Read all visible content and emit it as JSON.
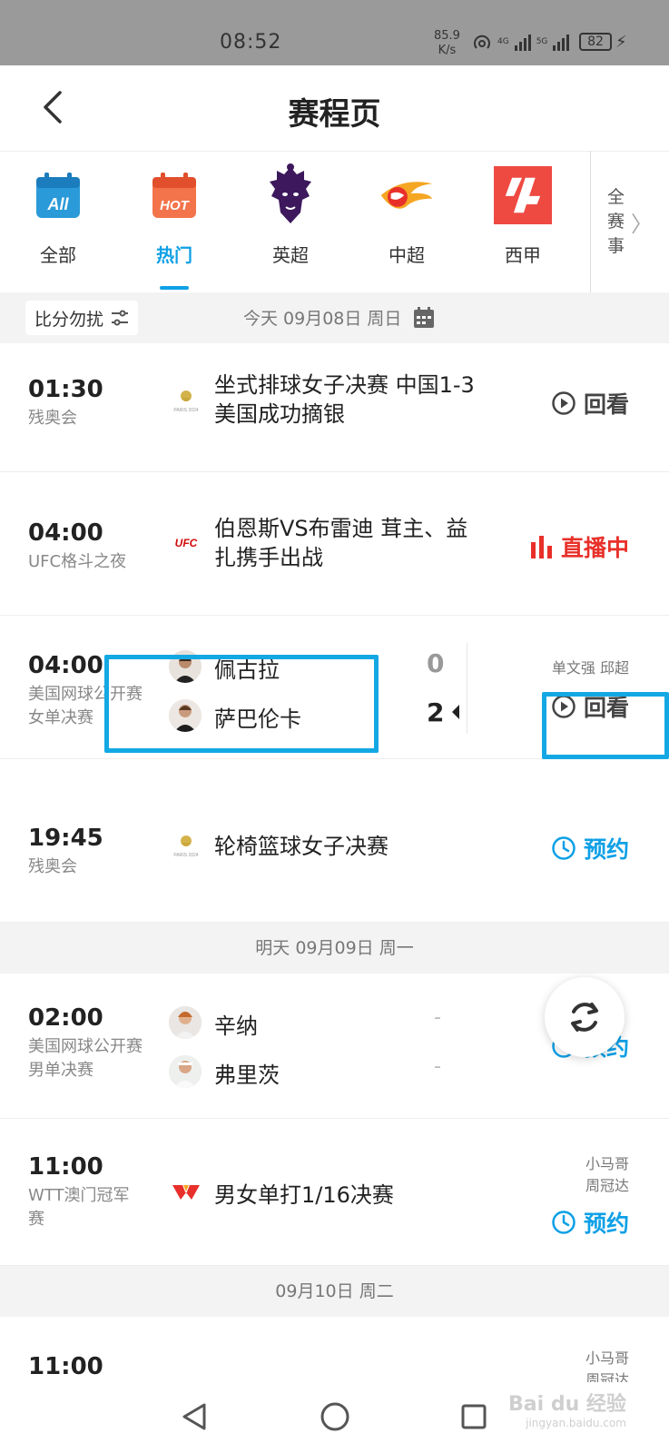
{
  "status_bar": {
    "time": "08:52",
    "speed_value": "85.9",
    "speed_unit": "K/s",
    "net1": "4G",
    "net2": "5G",
    "battery": "82"
  },
  "header": {
    "title": "赛程页"
  },
  "tabs": [
    {
      "label": "全部",
      "icon": "all-calendar-icon",
      "icon_text": "All",
      "active": false
    },
    {
      "label": "热门",
      "icon": "hot-calendar-icon",
      "icon_text": "HOT",
      "active": true
    },
    {
      "label": "英超",
      "icon": "premier-league-lion-icon",
      "active": false
    },
    {
      "label": "中超",
      "icon": "csl-ball-icon",
      "active": false
    },
    {
      "label": "西甲",
      "icon": "laliga-icon",
      "active": false
    }
  ],
  "all_competitions": {
    "label": [
      "全",
      "赛",
      "事"
    ]
  },
  "filter": {
    "no_disturb": "比分勿扰",
    "date": "今天 09月08日 周日"
  },
  "matches_today": [
    {
      "time": "01:30",
      "league": "残奥会",
      "logo": "paris-2024-logo",
      "desc": "坐式排球女子决赛 中国1-3美国成功摘银",
      "action": "回看",
      "action_type": "replay"
    },
    {
      "time": "04:00",
      "league": "UFC格斗之夜",
      "logo": "ufc-logo",
      "logo_text": "UFC",
      "desc": "伯恩斯VS布雷迪 茸主、益扎携手出战",
      "action": "直播中",
      "action_type": "live"
    },
    {
      "time": "04:00",
      "league": "美国网球公开赛女单决赛",
      "players": [
        {
          "name": "佩古拉",
          "score": "0"
        },
        {
          "name": "萨巴伦卡",
          "score": "2"
        }
      ],
      "commentators": "单文强 邱超",
      "action": "回看",
      "action_type": "replay"
    },
    {
      "time": "19:45",
      "league": "残奥会",
      "logo": "paris-2024-logo",
      "desc": "轮椅篮球女子决赛",
      "action": "预约",
      "action_type": "book"
    }
  ],
  "separator_tomorrow": "明天 09月09日 周一",
  "matches_tomorrow": [
    {
      "time": "02:00",
      "league": "美国网球公开赛男单决赛",
      "players": [
        {
          "name": "辛纳",
          "score": "-"
        },
        {
          "name": "弗里茨",
          "score": "-"
        }
      ],
      "action": "预约",
      "action_type": "book"
    },
    {
      "time": "11:00",
      "league": "WTT澳门冠军赛",
      "logo": "wtt-logo",
      "desc": "男女单打1/16决赛",
      "commentators": "小马哥 周冠达",
      "action": "预约",
      "action_type": "book"
    }
  ],
  "separator_day3": "09月10日 周二",
  "matches_day3": [
    {
      "time": "11:00",
      "commentators": "小马哥 周冠达"
    }
  ],
  "watermark": {
    "main": "Bai du 经验",
    "sub": "jingyan.baidu.com"
  },
  "colors": {
    "accent": "#0ea0e6",
    "live": "#e8302a",
    "highlight_box": "#13a8e4"
  }
}
